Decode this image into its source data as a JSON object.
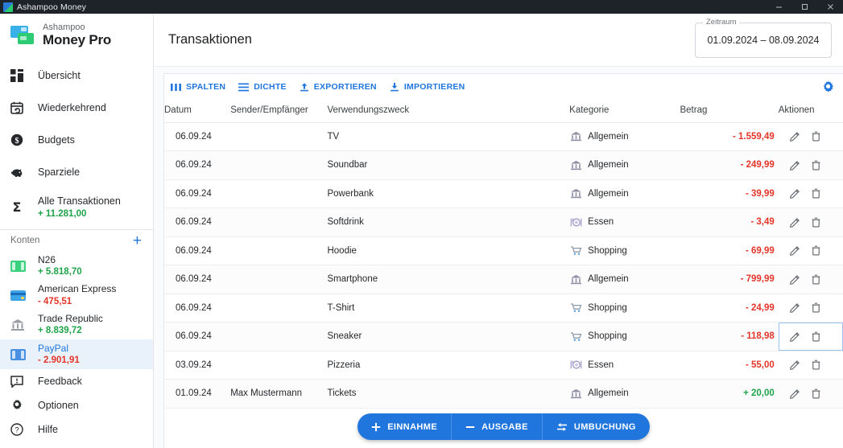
{
  "window": {
    "title": "Ashampoo Money",
    "app_icon": "app-logo-icon",
    "minimize": "—",
    "maximize": "□",
    "close": "✕"
  },
  "brand": {
    "sub": "Ashampoo",
    "name": "Money Pro"
  },
  "sidebar": {
    "nav": [
      {
        "label": "Übersicht",
        "icon": "dashboard-icon"
      },
      {
        "label": "Wiederkehrend",
        "icon": "calendar-repeat-icon"
      },
      {
        "label": "Budgets",
        "icon": "coin-dollar-icon"
      },
      {
        "label": "Sparziele",
        "icon": "piggy-bank-icon"
      },
      {
        "label": "Alle Transaktionen",
        "icon": "sigma-icon",
        "value": "+ 11.281,00",
        "value_sign": "positive"
      }
    ],
    "accounts_header": {
      "title": "Konten",
      "add": "+",
      "add_icon": "plus-icon"
    },
    "accounts": [
      {
        "name": "N26",
        "value": "+ 5.818,70",
        "value_sign": "positive",
        "icon": "banknote-green-icon",
        "active": false
      },
      {
        "name": "American Express",
        "value": "- 475,51",
        "value_sign": "negative",
        "icon": "credit-card-icon",
        "active": false
      },
      {
        "name": "Trade Republic",
        "value": "+ 8.839,72",
        "value_sign": "positive",
        "icon": "bank-icon",
        "active": false
      },
      {
        "name": "PayPal",
        "value": "- 2.901,91",
        "value_sign": "negative",
        "icon": "banknote-blue-icon",
        "active": true
      }
    ],
    "bottom": [
      {
        "label": "Feedback",
        "icon": "feedback-icon"
      },
      {
        "label": "Optionen",
        "icon": "gear-icon"
      },
      {
        "label": "Hilfe",
        "icon": "help-circle-icon"
      }
    ]
  },
  "header": {
    "title": "Transaktionen",
    "daterange": {
      "legend": "Zeitraum",
      "value": "01.09.2024 – 08.09.2024"
    }
  },
  "toolbar": {
    "actions": [
      {
        "label": "SPALTEN",
        "icon": "columns-icon"
      },
      {
        "label": "DICHTE",
        "icon": "density-icon"
      },
      {
        "label": "EXPORTIEREN",
        "icon": "upload-icon"
      },
      {
        "label": "IMPORTIEREN",
        "icon": "download-icon"
      }
    ],
    "settings_icon": "gear-icon"
  },
  "table": {
    "columns": [
      "Datum",
      "Sender/Empfänger",
      "Verwendungszweck",
      "Kategorie",
      "Betrag",
      "Aktionen"
    ],
    "rows": [
      {
        "datum": "06.09.24",
        "sender": "",
        "zweck": "TV",
        "kategorie": "Allgemein",
        "kat_icon": "bank-icon",
        "betrag": "- 1.559,49",
        "sign": "negative",
        "focused": false
      },
      {
        "datum": "06.09.24",
        "sender": "",
        "zweck": "Soundbar",
        "kategorie": "Allgemein",
        "kat_icon": "bank-icon",
        "betrag": "- 249,99",
        "sign": "negative",
        "focused": false
      },
      {
        "datum": "06.09.24",
        "sender": "",
        "zweck": "Powerbank",
        "kategorie": "Allgemein",
        "kat_icon": "bank-icon",
        "betrag": "- 39,99",
        "sign": "negative",
        "focused": false
      },
      {
        "datum": "06.09.24",
        "sender": "",
        "zweck": "Softdrink",
        "kategorie": "Essen",
        "kat_icon": "food-icon",
        "betrag": "- 3,49",
        "sign": "negative",
        "focused": false
      },
      {
        "datum": "06.09.24",
        "sender": "",
        "zweck": "Hoodie",
        "kategorie": "Shopping",
        "kat_icon": "cart-icon",
        "betrag": "- 69,99",
        "sign": "negative",
        "focused": false
      },
      {
        "datum": "06.09.24",
        "sender": "",
        "zweck": "Smartphone",
        "kategorie": "Allgemein",
        "kat_icon": "bank-icon",
        "betrag": "- 799,99",
        "sign": "negative",
        "focused": false
      },
      {
        "datum": "06.09.24",
        "sender": "",
        "zweck": "T-Shirt",
        "kategorie": "Shopping",
        "kat_icon": "cart-icon",
        "betrag": "- 24,99",
        "sign": "negative",
        "focused": false
      },
      {
        "datum": "06.09.24",
        "sender": "",
        "zweck": "Sneaker",
        "kategorie": "Shopping",
        "kat_icon": "cart-icon",
        "betrag": "- 118,98",
        "sign": "negative",
        "focused": true
      },
      {
        "datum": "03.09.24",
        "sender": "",
        "zweck": "Pizzeria",
        "kategorie": "Essen",
        "kat_icon": "food-icon",
        "betrag": "- 55,00",
        "sign": "negative",
        "focused": false
      },
      {
        "datum": "01.09.24",
        "sender": "Max Mustermann",
        "zweck": "Tickets",
        "kategorie": "Allgemein",
        "kat_icon": "bank-icon",
        "betrag": "+ 20,00",
        "sign": "positive",
        "focused": false
      }
    ],
    "row_actions": {
      "edit_icon": "pencil-icon",
      "delete_icon": "trash-icon"
    }
  },
  "fab": {
    "buttons": [
      {
        "label": "EINNAHME",
        "icon": "plus-icon"
      },
      {
        "label": "AUSGABE",
        "icon": "minus-icon"
      },
      {
        "label": "UMBUCHUNG",
        "icon": "transfer-icon"
      }
    ]
  },
  "colors": {
    "accent": "#2176de",
    "positive": "#1fa34a",
    "negative": "#e4352a",
    "titlebar": "#1e2229",
    "active_row": "#e9f1fb"
  }
}
